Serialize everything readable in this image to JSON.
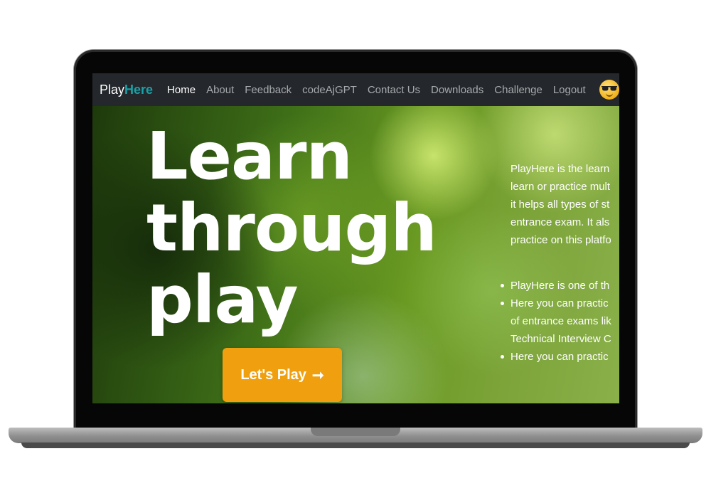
{
  "navbar": {
    "brand_part1": "Play",
    "brand_part2": "Here",
    "items": [
      "Home",
      "About",
      "Feedback",
      "codeAjGPT",
      "Contact Us",
      "Downloads",
      "Challenge",
      "Logout"
    ],
    "active_item": "Home",
    "avatar_icon": "sunglasses-emoji-icon"
  },
  "hero": {
    "title_lines": [
      "Learn",
      "through",
      "play"
    ],
    "cta_label": "Let's Play",
    "cta_arrow": "➞",
    "intro_lines": [
      "PlayHere is the learn",
      "learn or practice mult",
      "it helps all types of st",
      "entrance exam. It als",
      "practice on this platfo"
    ],
    "features": [
      {
        "lines": [
          "PlayHere is one of th"
        ]
      },
      {
        "lines": [
          "Here you can practic",
          "of entrance exams lik",
          "Technical Interview C"
        ]
      },
      {
        "lines": [
          "Here you can practic"
        ]
      }
    ]
  },
  "colors": {
    "navbar_bg": "#24272b",
    "brand_accent": "#1aa1a8",
    "cta_bg": "#f0a00f"
  }
}
